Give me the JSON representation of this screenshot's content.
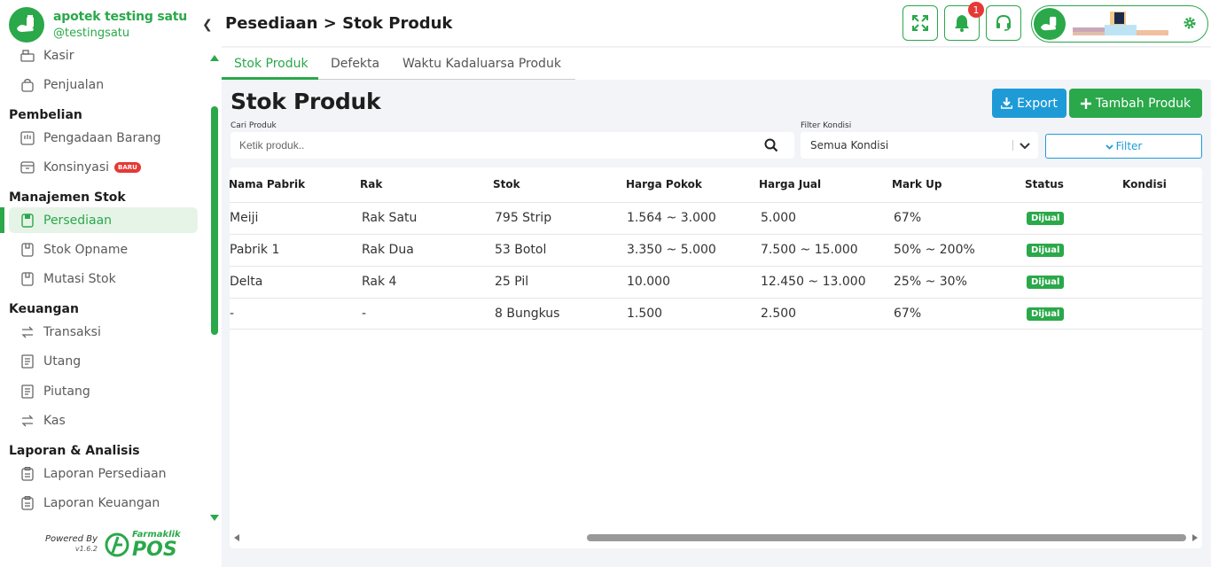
{
  "brand": {
    "name": "apotek testing satu",
    "username": "@testingsatu"
  },
  "sidebar": {
    "items": [
      {
        "label": "Kasir",
        "icon": "cash-register-icon"
      },
      {
        "label": "Penjualan",
        "icon": "bag-icon"
      },
      {
        "section": "Pembelian"
      },
      {
        "label": "Pengadaan Barang",
        "icon": "procurement-icon"
      },
      {
        "label": "Konsinyasi",
        "icon": "box-icon",
        "badge": "BARU"
      },
      {
        "section": "Manajemen Stok"
      },
      {
        "label": "Persediaan",
        "icon": "inventory-icon",
        "active": true
      },
      {
        "label": "Stok Opname",
        "icon": "stock-opname-icon"
      },
      {
        "label": "Mutasi Stok",
        "icon": "stock-mutation-icon"
      },
      {
        "section": "Keuangan"
      },
      {
        "label": "Transaksi",
        "icon": "transfer-icon"
      },
      {
        "label": "Utang",
        "icon": "receipt-icon"
      },
      {
        "label": "Piutang",
        "icon": "receipt-icon"
      },
      {
        "label": "Kas",
        "icon": "transfer-icon"
      },
      {
        "section": "Laporan & Analisis"
      },
      {
        "label": "Laporan Persediaan",
        "icon": "clipboard-icon"
      },
      {
        "label": "Laporan Keuangan",
        "icon": "clipboard-icon"
      }
    ]
  },
  "footer": {
    "powered_by": "Powered By",
    "version": "v1.6.2",
    "logo_name": "Farmaklik",
    "logo_pos": "POS"
  },
  "header": {
    "breadcrumb": "Pesediaan > Stok Produk",
    "notification_count": "1"
  },
  "tabs": [
    {
      "label": "Stok Produk",
      "active": true
    },
    {
      "label": "Defekta",
      "active": false
    },
    {
      "label": "Waktu Kadaluarsa Produk",
      "active": false
    }
  ],
  "main": {
    "title": "Stok Produk",
    "export_label": "Export",
    "add_label": "Tambah Produk",
    "search_label": "Cari Produk",
    "search_placeholder": "Ketik produk..",
    "filter_label": "Filter Kondisi",
    "filter_value": "Semua Kondisi",
    "filter_button": "Filter"
  },
  "table": {
    "columns": [
      "Nama Pabrik",
      "Rak",
      "Stok",
      "Harga Pokok",
      "Harga Jual",
      "Mark Up",
      "Status",
      "Kondisi"
    ],
    "rows": [
      [
        "Meiji",
        "Rak Satu",
        "795 Strip",
        "1.564 ~ 3.000",
        "5.000",
        "67%",
        "Dijual",
        ""
      ],
      [
        "Pabrik 1",
        "Rak Dua",
        "53 Botol",
        "3.350 ~ 5.000",
        "7.500 ~ 15.000",
        "50% ~ 200%",
        "Dijual",
        ""
      ],
      [
        "Delta",
        "Rak 4",
        "25 Pil",
        "10.000",
        "12.450 ~ 13.000",
        "25% ~ 30%",
        "Dijual",
        ""
      ],
      [
        "-",
        "-",
        "8 Bungkus",
        "1.500",
        "2.500",
        "67%",
        "Dijual",
        ""
      ]
    ]
  },
  "colors": {
    "primary": "#2aa84a",
    "info": "#1e9bd7",
    "danger": "#e53935"
  }
}
